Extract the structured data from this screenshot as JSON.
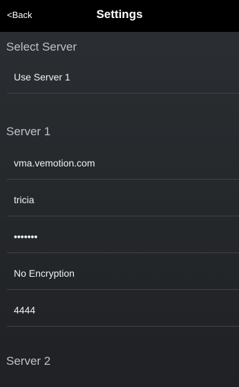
{
  "header": {
    "back_label": "<Back",
    "title": "Settings"
  },
  "select_server": {
    "heading": "Select Server",
    "value": "Use Server 1"
  },
  "server1": {
    "heading": "Server 1",
    "host": "vma.vemotion.com",
    "username": "tricia",
    "password_mask": "•••••••",
    "encryption": "No Encryption",
    "port": "4444"
  },
  "server2": {
    "heading": "Server 2"
  },
  "colors": {
    "topbar": "#000000",
    "background": "#26292c",
    "separator": "#3e4247",
    "heading": "#bfc3c7"
  }
}
